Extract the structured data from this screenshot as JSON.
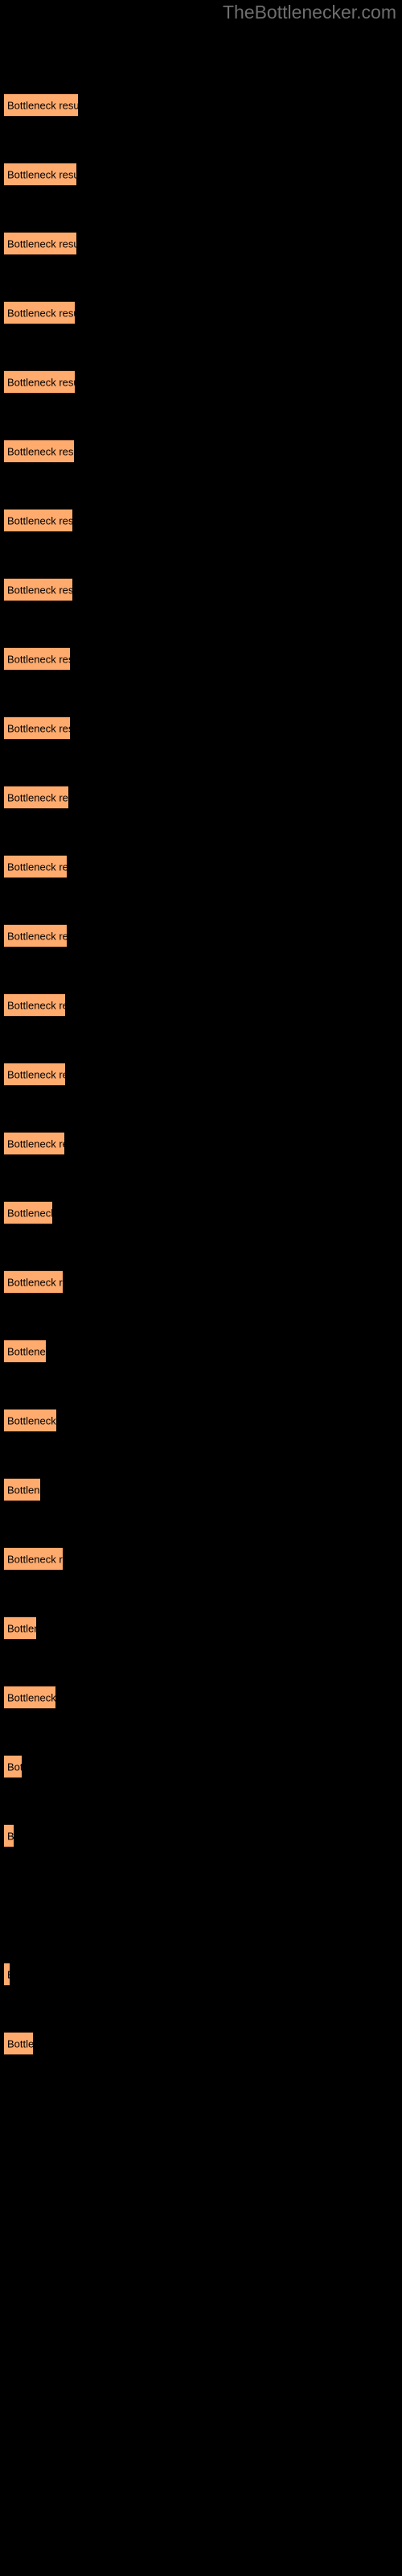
{
  "header": {
    "site_title": "TheBottlenecker.com",
    "site_title_color": "#6e6e6e"
  },
  "colors": {
    "background": "#000000",
    "bar_fill": "#ffab6e",
    "bar_edge": "#2a1708",
    "bar_label_text": "#000000"
  },
  "chart_data": {
    "type": "bar",
    "orientation": "horizontal",
    "title": "",
    "subtitle": "",
    "xlabel": "",
    "ylabel": "",
    "grid": false,
    "legend": null,
    "bar_label_text": "Bottleneck result",
    "axis_tick_labels": [],
    "categories": [
      "Bottleneck result",
      "Bottleneck result",
      "Bottleneck result",
      "Bottleneck result",
      "Bottleneck result",
      "Bottleneck result",
      "Bottleneck result",
      "Bottleneck result",
      "Bottleneck result",
      "Bottleneck result",
      "Bottleneck result",
      "Bottleneck result",
      "Bottleneck result",
      "Bottleneck result",
      "Bottleneck result",
      "Bottleneck result",
      "Bottleneck result",
      "Bottleneck result",
      "Bottleneck result",
      "Bottleneck result",
      "Bottleneck result",
      "Bottleneck result",
      "Bottleneck result",
      "Bottleneck result",
      "Bottleneck result",
      "Bottleneck result",
      "Bottleneck result",
      "Bottleneck result",
      "Bottleneck result"
    ],
    "values": [
      92,
      90,
      90,
      88,
      88,
      87,
      85,
      85,
      82,
      82,
      80,
      78,
      78,
      76,
      76,
      75,
      60,
      73,
      52,
      65,
      45,
      73,
      40,
      64,
      22,
      12,
      0,
      7,
      36
    ],
    "value_unit": "px-width",
    "xlim": [
      0,
      500
    ]
  },
  "bars": [
    {
      "label": "Bottleneck result",
      "y": 58,
      "width": 92
    },
    {
      "label": "Bottleneck result",
      "y": 101,
      "width": 90
    },
    {
      "label": "Bottleneck result",
      "y": 144,
      "width": 90
    },
    {
      "label": "Bottleneck result",
      "y": 187,
      "width": 88
    },
    {
      "label": "Bottleneck result",
      "y": 230,
      "width": 88
    },
    {
      "label": "Bottleneck result",
      "y": 273,
      "width": 87
    },
    {
      "label": "Bottleneck result",
      "y": 316,
      "width": 85
    },
    {
      "label": "Bottleneck result",
      "y": 359,
      "width": 85
    },
    {
      "label": "Bottleneck result",
      "y": 402,
      "width": 82
    },
    {
      "label": "Bottleneck result",
      "y": 445,
      "width": 82
    },
    {
      "label": "Bottleneck result",
      "y": 488,
      "width": 80
    },
    {
      "label": "Bottleneck result",
      "y": 531,
      "width": 78
    },
    {
      "label": "Bottleneck result",
      "y": 574,
      "width": 78
    },
    {
      "label": "Bottleneck result",
      "y": 617,
      "width": 76
    },
    {
      "label": "Bottleneck result",
      "y": 660,
      "width": 76
    },
    {
      "label": "Bottleneck result",
      "y": 703,
      "width": 75
    },
    {
      "label": "Bottleneck result",
      "y": 746,
      "width": 60
    },
    {
      "label": "Bottleneck result",
      "y": 789,
      "width": 73
    },
    {
      "label": "Bottleneck result",
      "y": 832,
      "width": 52
    },
    {
      "label": "Bottleneck result",
      "y": 875,
      "width": 65
    },
    {
      "label": "Bottleneck result",
      "y": 918,
      "width": 45
    },
    {
      "label": "Bottleneck result",
      "y": 961,
      "width": 73
    },
    {
      "label": "Bottleneck result",
      "y": 1004,
      "width": 40
    },
    {
      "label": "Bottleneck result",
      "y": 1047,
      "width": 64
    },
    {
      "label": "Bottleneck result",
      "y": 1090,
      "width": 22
    },
    {
      "label": "Bottleneck result",
      "y": 1133,
      "width": 12
    },
    {
      "label": "Bottleneck result",
      "y": 1219,
      "width": 7
    },
    {
      "label": "Bottleneck result",
      "y": 1262,
      "width": 36
    }
  ]
}
